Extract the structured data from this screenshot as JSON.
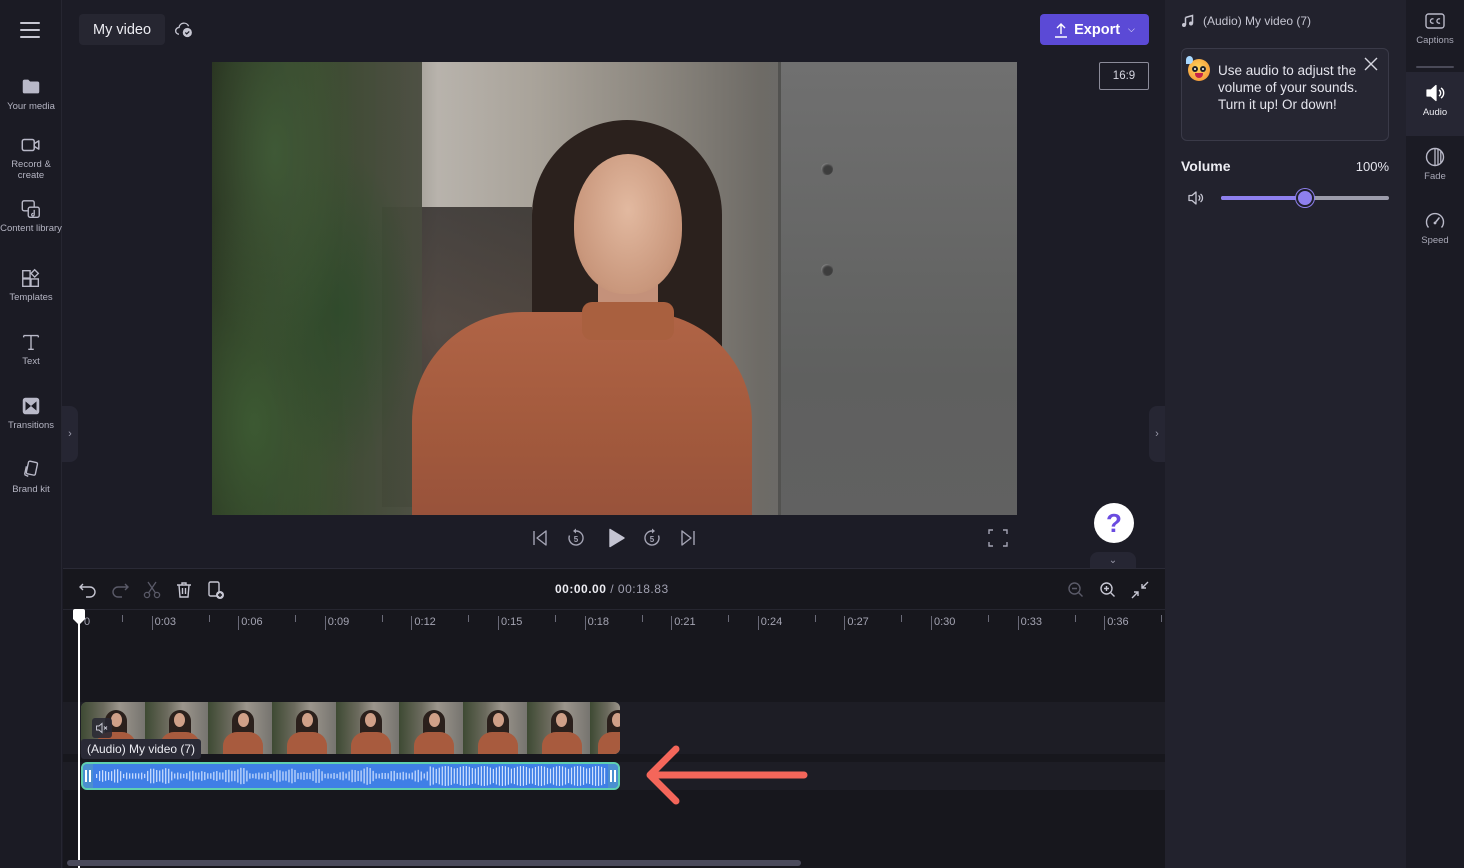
{
  "app": {
    "project_title": "My video",
    "export_label": "Export",
    "aspect_ratio": "16:9"
  },
  "left_nav": {
    "items": [
      {
        "id": "your-media",
        "label": "Your media",
        "icon": "folder-icon"
      },
      {
        "id": "record-create",
        "label": "Record & create",
        "icon": "video-camera-icon"
      },
      {
        "id": "content-library",
        "label": "Content library",
        "icon": "content-library-icon"
      },
      {
        "id": "templates",
        "label": "Templates",
        "icon": "templates-icon"
      },
      {
        "id": "text",
        "label": "Text",
        "icon": "text-icon"
      },
      {
        "id": "transitions",
        "label": "Transitions",
        "icon": "transitions-icon"
      },
      {
        "id": "brand-kit",
        "label": "Brand kit",
        "icon": "brand-kit-icon"
      }
    ]
  },
  "player": {
    "controls": [
      "skip-to-start",
      "rewind-5s",
      "play",
      "forward-5s",
      "skip-to-end"
    ],
    "rewind_seconds": "5",
    "forward_seconds": "5",
    "help_label": "?"
  },
  "timeline": {
    "current_time": "00:00.00",
    "separator": "/",
    "total_time": "00:18.83",
    "ruler_labels": [
      "0",
      "0:03",
      "0:06",
      "0:09",
      "0:12",
      "0:15",
      "0:18",
      "0:21",
      "0:24",
      "0:27",
      "0:30",
      "0:33",
      "0:36"
    ],
    "clip_label": "(Audio) My video (7)",
    "playhead_position_seconds": 0
  },
  "properties": {
    "clip_title": "(Audio) My video (7)",
    "tip_text": "Use audio to adjust the volume of your sounds. Turn it up! Or down!",
    "volume_label": "Volume",
    "volume_value": "100%",
    "volume_fraction": 0.5
  },
  "right_rail": {
    "items": [
      {
        "id": "captions",
        "label": "Captions",
        "active": false
      },
      {
        "id": "audio",
        "label": "Audio",
        "active": true
      },
      {
        "id": "fade",
        "label": "Fade",
        "active": false
      },
      {
        "id": "speed",
        "label": "Speed",
        "active": false
      }
    ]
  },
  "colors": {
    "accent": "#5b4ad6",
    "slider_accent": "#8e80ee",
    "audio_clip": "#3f7fe6",
    "audio_clip_border": "#5fcfb0",
    "annotation_arrow": "#f4665a"
  }
}
